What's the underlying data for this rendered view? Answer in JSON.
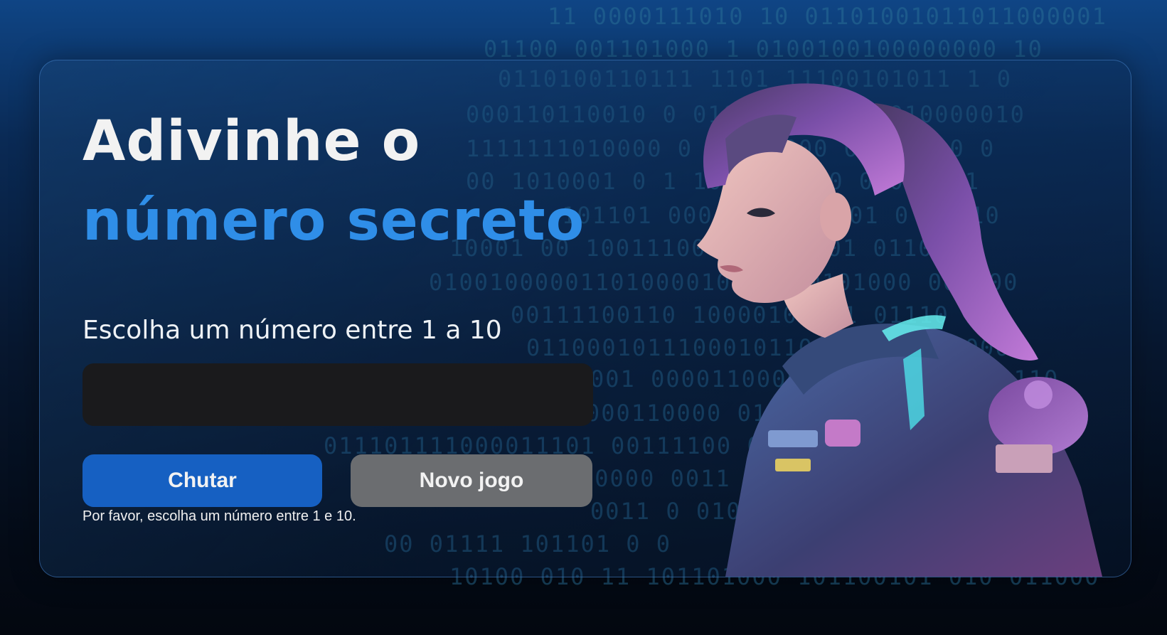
{
  "background": {
    "binary_lines": [
      "11 0000111010 10 01101001011011000001",
      "01100 001101000 1  0100100100000000 10",
      "0110100110111  1101  11100101011 1 0",
      "000110110010  0  0101101  10111010000010",
      "1111111010000  0 01001000 000011 0 0",
      "00 1010001 0  1  10  10 0010  0 001011",
      "101101 000  1001  0 001  0 01 10",
      "10001 00 10011100001  1 1001  01101",
      "01001000001101000010010 00101000 001000",
      "00111100110  100001000 1 01110  10",
      "0110001011100010110 1000  0 01000",
      "001 0000110000 10010110011  0110",
      "0 000 01101000110000 01  100110",
      "011101111000011101  00111100 0 0",
      "00000 0011 00110  101  1 0",
      "0011 0 01001110  01 0",
      "00 01111 101101 0 0",
      "10100 010 11 101101000 101100101 010 011000"
    ]
  },
  "heading": {
    "line1": "Adivinhe o",
    "line2": "número secreto"
  },
  "prompt": "Escolha um número entre 1 a 10",
  "input": {
    "value": "",
    "placeholder": ""
  },
  "buttons": {
    "guess": "Chutar",
    "new_game": "Novo jogo"
  },
  "message": "Por favor, escolha um número entre 1 e 10.",
  "colors": {
    "accent": "#2f8ee8",
    "guess_button": "#1660c2",
    "new_game_button": "#6b6d70",
    "input_bg": "#1a1a1c"
  }
}
